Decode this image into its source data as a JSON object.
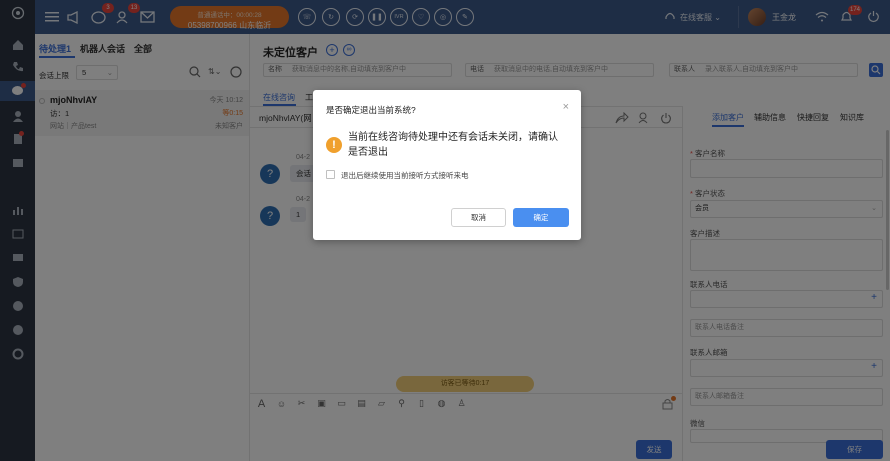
{
  "topbar": {
    "call_status": "普通通话中：00:00:28",
    "call_number": "05398700966 山东临沂",
    "badges": {
      "message": "3",
      "users": "13",
      "alerts": "174"
    },
    "status_label": "在线客服",
    "username": "王金龙",
    "control_labels": [
      "IVR"
    ]
  },
  "left": {
    "tabs": [
      "待处理1",
      "机器人会话",
      "全部"
    ],
    "limit_label": "会话上限",
    "limit_value": "5",
    "session": {
      "name": "mjoNhvlAY",
      "time": "今天 10:12",
      "visits": "访：1",
      "wait": "等0:15",
      "source": "网站｜产品test",
      "type": "未知客户"
    }
  },
  "main": {
    "title": "未定位客户",
    "fields": [
      {
        "label": "名称",
        "placeholder": "获取消息中的名称,自动填充到客户中"
      },
      {
        "label": "电话",
        "placeholder": "获取消息中的电话,自动填充到客户中"
      },
      {
        "label": "联系人",
        "placeholder": "录入联系人,自动填充到客户中"
      }
    ],
    "tabs": [
      "在线咨询",
      "工"
    ],
    "visitor": "mjoNhvlAY(网",
    "msg_date1": "04-2",
    "msg_text1": "会话",
    "msg_date2": "04-2",
    "msg_text2": "1",
    "wait_banner": "访客已等待0:17",
    "send_label": "发送"
  },
  "right": {
    "tabs": [
      "添加客户",
      "辅助信息",
      "快捷回复",
      "知识库"
    ],
    "customer_name_label": "客户名称",
    "customer_status_label": "客户状态",
    "customer_status_value": "会员",
    "customer_desc_label": "客户描述",
    "contact_phone_label": "联系人电话",
    "phone_note_placeholder": "联系人电话备注",
    "contact_email_label": "联系人邮箱",
    "email_note_placeholder": "联系人邮箱备注",
    "wechat_label": "微信",
    "save_label": "保存"
  },
  "dialog": {
    "title": "是否确定退出当前系统?",
    "message": "当前在线咨询待处理中还有会话未关闭，请确认是否退出",
    "checkbox_label": "退出后继续使用当前接听方式接听来电",
    "cancel_label": "取消",
    "confirm_label": "确定"
  }
}
